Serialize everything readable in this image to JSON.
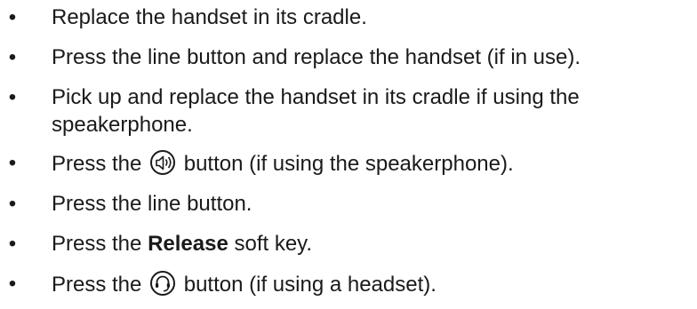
{
  "items": [
    {
      "text": "Replace the handset in its cradle."
    },
    {
      "text": "Press the line button and replace the handset (if in use)."
    },
    {
      "line1": "Pick up and replace the handset in its cradle if using the",
      "line2": "speakerphone."
    },
    {
      "before": "Press the",
      "icon": "speakerphone-icon",
      "after": "button (if using the speakerphone)."
    },
    {
      "text": "Press the line button."
    },
    {
      "before": "Press the",
      "bold": "Release",
      "after": "soft key."
    },
    {
      "before": "Press the",
      "icon": "headset-icon",
      "after": "button (if using a headset)."
    }
  ],
  "bullet_char": "•"
}
